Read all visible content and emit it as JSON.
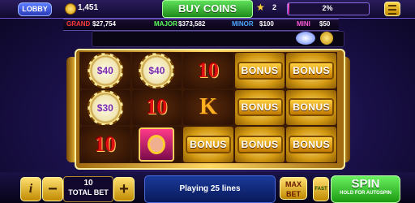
{
  "top": {
    "lobby": "LOBBY",
    "balance": "1,451",
    "buy_coins": "BUY COINS",
    "level": "2",
    "xp_percent": "2%",
    "xp_fraction": 0.02
  },
  "jackpots": [
    {
      "name": "GRAND",
      "value": "$27,754",
      "color": "#ff3a3a"
    },
    {
      "name": "MAJOR",
      "value": "$373,582",
      "color": "#5aff5a"
    },
    {
      "name": "MINOR",
      "value": "$100",
      "color": "#4aa8ff"
    },
    {
      "name": "MINI",
      "value": "$50",
      "color": "#ff5ad8"
    }
  ],
  "reels": {
    "chip_values": [
      "$40",
      "$40",
      "$30"
    ],
    "bonus_label": "BONUS",
    "ten_label": "10",
    "king_label": "K"
  },
  "controls": {
    "info": "i",
    "minus": "−",
    "plus": "+",
    "bet_value": "10",
    "bet_label": "TOTAL BET",
    "message": "Playing 25 lines",
    "max_bet": "MAX BET",
    "fast": "FAST",
    "spin": "SPIN",
    "spin_sub": "HOLD FOR AUTOSPIN"
  }
}
